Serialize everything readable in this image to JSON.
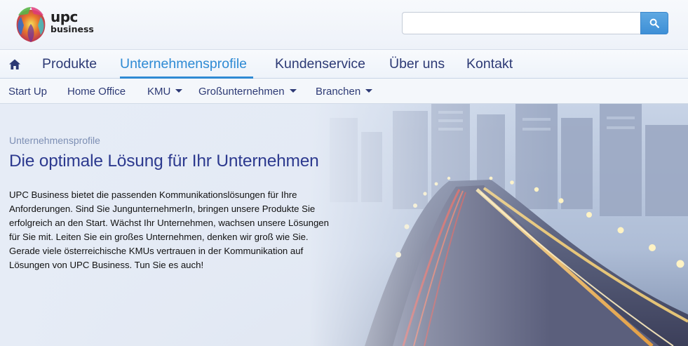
{
  "brand": {
    "name": "upc",
    "tagline": "business"
  },
  "search": {
    "value": "",
    "placeholder": ""
  },
  "colors": {
    "nav_text": "#2d3a75",
    "accent": "#2e8ad4",
    "headline": "#2d3a8f",
    "search_button": "#3e8fd6"
  },
  "main_nav": {
    "home_icon": "home-icon",
    "items": [
      {
        "label": "Produkte"
      },
      {
        "label": "Unternehmensprofile",
        "active": true
      },
      {
        "label": "Kundenservice"
      },
      {
        "label": "Über uns"
      },
      {
        "label": "Kontakt"
      }
    ]
  },
  "sub_nav": {
    "items": [
      {
        "label": "Start Up",
        "dropdown": false
      },
      {
        "label": "Home Office",
        "dropdown": false
      },
      {
        "label": "KMU",
        "dropdown": true
      },
      {
        "label": "Großunternehmen",
        "dropdown": true
      },
      {
        "label": "Branchen",
        "dropdown": true
      }
    ]
  },
  "hero": {
    "kicker": "Unternehmensprofile",
    "headline": "Die optimale Lösung für Ihr Unternehmen",
    "body": "UPC Business bietet die passenden Kommunikationslösungen für Ihre Anforderungen. Sind Sie JungunternehmerIn, bringen unsere Produkte Sie erfolgreich an den Start. Wächst Ihr Unternehmen, wachsen unsere Lösungen für Sie mit. Leiten Sie ein großes Unternehmen, denken wir groß wie Sie. Gerade viele österreichische KMUs vertrauen in der Kommunikation auf Lösungen von UPC Business. Tun Sie es auch!"
  }
}
